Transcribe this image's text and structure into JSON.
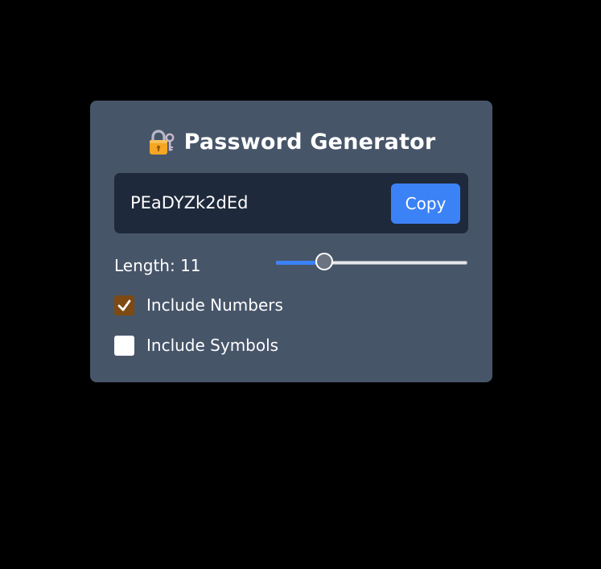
{
  "app": {
    "title": "Password Generator",
    "lock_icon": "lock-with-key-icon"
  },
  "password": {
    "value": "PEaDYZk2dEd",
    "copy_label": "Copy"
  },
  "length": {
    "label": "Length: 11",
    "value": 11,
    "min": 4,
    "max": 32
  },
  "options": [
    {
      "label": "Include Numbers",
      "checked": true
    },
    {
      "label": "Include Symbols",
      "checked": false
    }
  ],
  "colors": {
    "background": "#000000",
    "card": "#475569",
    "password_box": "#1e293b",
    "accent": "#3b82f6",
    "checked_box": "#7c4a12"
  }
}
